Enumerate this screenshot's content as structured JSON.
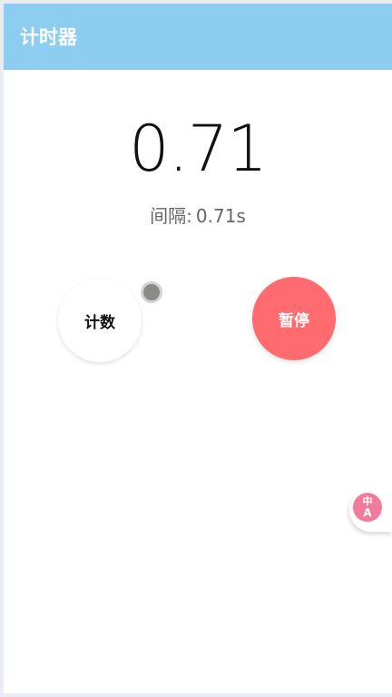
{
  "header": {
    "title": "计时器",
    "background": "#8ccdf0"
  },
  "timer": {
    "value": "0.71",
    "interval_label": "间隔:",
    "interval_value": "0.71s"
  },
  "buttons": {
    "count_label": "计数",
    "pause_label": "暂停",
    "pause_color": "#ff6b6e"
  },
  "floating": {
    "translate_icon": "translate-icon",
    "translate_glyph_top": "中",
    "translate_glyph_bottom": "A"
  }
}
